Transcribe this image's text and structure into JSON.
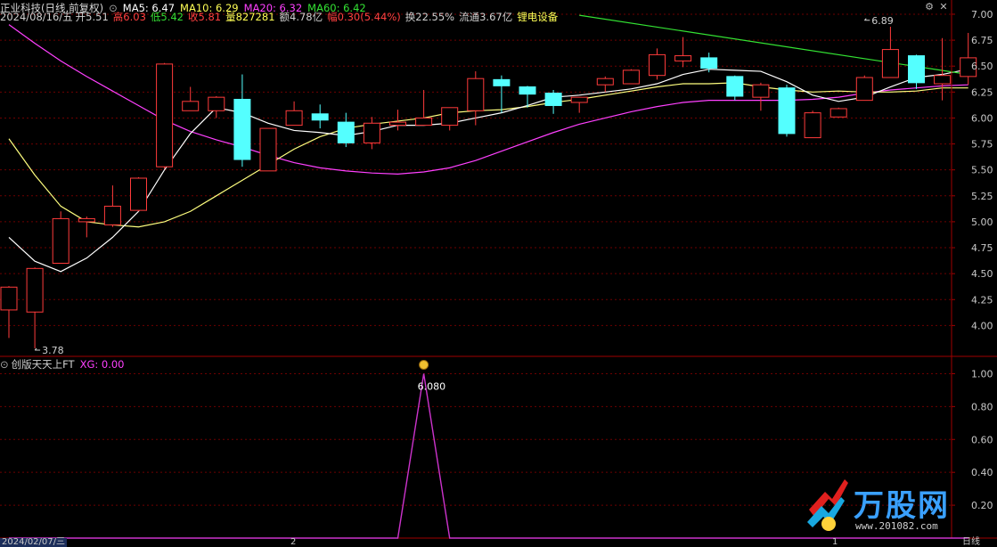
{
  "header": {
    "stock": "正业科技(日线,前复权)",
    "ma5": "MA5: 6.47",
    "ma10": "MA10: 6.29",
    "ma20": "MA20: 6.32",
    "ma60": "MA60: 6.42",
    "date": "2024/08/16/五",
    "open": "开5.51",
    "high": "高6.03",
    "low": "低5.42",
    "close": "收5.81",
    "volume": "量827281",
    "amount": "额4.78亿",
    "change": "幅0.30(5.44%)",
    "turnover": "换22.55%",
    "float_cap": "流通3.67亿",
    "sector": "锂电设备"
  },
  "indicator": {
    "name": "创版天天上FT",
    "value": "XG: 0.00",
    "peak_label": "6.080"
  },
  "footer": {
    "date_box": "2024/02/07/三",
    "mark1": "2",
    "mark2": "1",
    "period": "日线"
  },
  "window_controls": {
    "settings": "gear-icon",
    "close": "close-icon"
  },
  "brand": {
    "text": "万股网",
    "url": "www.201082.com"
  },
  "colors": {
    "up": "#ff3b3b",
    "down": "#54ffff",
    "ma5": "#ffffff",
    "ma10": "#ffff7f",
    "ma20": "#ff40ff",
    "ma60": "#33e233",
    "axis": "#a00000",
    "grid": "#6e0000"
  },
  "chart_data": [
    {
      "type": "candlestick",
      "title": "正业科技(日线,前复权)",
      "ylim": [
        3.72,
        7.12
      ],
      "y_ticks": [
        "7.00",
        "6.75",
        "6.50",
        "6.25",
        "6.00",
        "5.75",
        "5.50",
        "5.25",
        "5.00",
        "4.75",
        "4.50",
        "4.25",
        "4.00"
      ],
      "annotations": [
        {
          "label": "3.78",
          "x": 1,
          "y": 3.78
        },
        {
          "label": "6.89",
          "x": 33,
          "y": 6.89
        }
      ],
      "candles": [
        {
          "o": 4.15,
          "h": 4.38,
          "l": 3.88,
          "c": 4.37
        },
        {
          "o": 4.13,
          "h": 4.56,
          "l": 3.78,
          "c": 4.55
        },
        {
          "o": 4.6,
          "h": 5.1,
          "l": 4.6,
          "c": 5.03
        },
        {
          "o": 5.0,
          "h": 5.05,
          "l": 4.85,
          "c": 5.03
        },
        {
          "o": 4.97,
          "h": 5.35,
          "l": 4.95,
          "c": 5.15
        },
        {
          "o": 5.11,
          "h": 5.43,
          "l": 5.1,
          "c": 5.42
        },
        {
          "o": 5.53,
          "h": 6.53,
          "l": 5.51,
          "c": 6.52
        },
        {
          "o": 6.07,
          "h": 6.3,
          "l": 6.07,
          "c": 6.16
        },
        {
          "o": 6.07,
          "h": 6.21,
          "l": 6.0,
          "c": 6.2
        },
        {
          "o": 6.18,
          "h": 6.42,
          "l": 5.53,
          "c": 5.6
        },
        {
          "o": 5.49,
          "h": 5.9,
          "l": 5.49,
          "c": 5.9
        },
        {
          "o": 5.93,
          "h": 6.16,
          "l": 5.93,
          "c": 6.07
        },
        {
          "o": 6.04,
          "h": 6.13,
          "l": 5.9,
          "c": 5.98
        },
        {
          "o": 5.96,
          "h": 6.05,
          "l": 5.72,
          "c": 5.76
        },
        {
          "o": 5.76,
          "h": 6.01,
          "l": 5.7,
          "c": 5.95
        },
        {
          "o": 5.93,
          "h": 6.08,
          "l": 5.88,
          "c": 5.96
        },
        {
          "o": 5.93,
          "h": 6.27,
          "l": 5.93,
          "c": 6.0
        },
        {
          "o": 5.93,
          "h": 6.1,
          "l": 5.88,
          "c": 6.1
        },
        {
          "o": 6.07,
          "h": 6.45,
          "l": 5.93,
          "c": 6.38
        },
        {
          "o": 6.37,
          "h": 6.41,
          "l": 6.05,
          "c": 6.31
        },
        {
          "o": 6.3,
          "h": 6.31,
          "l": 6.1,
          "c": 6.23
        },
        {
          "o": 6.24,
          "h": 6.27,
          "l": 6.04,
          "c": 6.12
        },
        {
          "o": 6.15,
          "h": 6.2,
          "l": 6.05,
          "c": 6.2
        },
        {
          "o": 6.32,
          "h": 6.4,
          "l": 6.25,
          "c": 6.38
        },
        {
          "o": 6.33,
          "h": 6.47,
          "l": 6.33,
          "c": 6.46
        },
        {
          "o": 6.41,
          "h": 6.67,
          "l": 6.37,
          "c": 6.61
        },
        {
          "o": 6.55,
          "h": 6.78,
          "l": 6.49,
          "c": 6.6
        },
        {
          "o": 6.58,
          "h": 6.63,
          "l": 6.44,
          "c": 6.48
        },
        {
          "o": 6.4,
          "h": 6.41,
          "l": 6.17,
          "c": 6.21
        },
        {
          "o": 6.2,
          "h": 6.34,
          "l": 6.07,
          "c": 6.32
        },
        {
          "o": 6.29,
          "h": 6.32,
          "l": 5.82,
          "c": 5.85
        },
        {
          "o": 5.81,
          "h": 6.07,
          "l": 5.81,
          "c": 6.05
        },
        {
          "o": 6.01,
          "h": 6.1,
          "l": 6.01,
          "c": 6.09
        },
        {
          "o": 6.17,
          "h": 6.41,
          "l": 6.17,
          "c": 6.39
        },
        {
          "o": 6.39,
          "h": 6.88,
          "l": 6.39,
          "c": 6.66
        },
        {
          "o": 6.6,
          "h": 6.61,
          "l": 6.28,
          "c": 6.34
        },
        {
          "o": 6.33,
          "h": 6.77,
          "l": 6.17,
          "c": 6.41
        },
        {
          "o": 6.4,
          "h": 6.82,
          "l": 6.32,
          "c": 6.58
        }
      ],
      "ma5": [
        4.85,
        4.62,
        4.52,
        4.65,
        4.85,
        5.1,
        5.5,
        5.85,
        6.1,
        6.05,
        5.95,
        5.88,
        5.86,
        5.83,
        5.87,
        5.93,
        5.93,
        5.95,
        6.0,
        6.05,
        6.12,
        6.2,
        6.22,
        6.25,
        6.28,
        6.33,
        6.42,
        6.47,
        6.46,
        6.45,
        6.35,
        6.22,
        6.16,
        6.2,
        6.3,
        6.39,
        6.42,
        6.47
      ],
      "ma10": [
        5.8,
        5.45,
        5.15,
        5.0,
        4.97,
        4.95,
        5.0,
        5.1,
        5.25,
        5.4,
        5.55,
        5.7,
        5.82,
        5.9,
        5.94,
        5.97,
        6.0,
        6.05,
        6.07,
        6.08,
        6.11,
        6.15,
        6.18,
        6.22,
        6.26,
        6.3,
        6.33,
        6.33,
        6.34,
        6.3,
        6.27,
        6.25,
        6.26,
        6.25,
        6.25,
        6.26,
        6.29,
        6.29
      ],
      "ma20": [
        6.9,
        6.72,
        6.55,
        6.4,
        6.26,
        6.12,
        5.98,
        5.87,
        5.79,
        5.72,
        5.64,
        5.57,
        5.52,
        5.49,
        5.47,
        5.46,
        5.48,
        5.52,
        5.59,
        5.68,
        5.77,
        5.86,
        5.94,
        6.0,
        6.06,
        6.11,
        6.15,
        6.17,
        6.17,
        6.17,
        6.17,
        6.18,
        6.2,
        6.24,
        6.27,
        6.29,
        6.31,
        6.32
      ],
      "ma60_segment": {
        "from_x": 22,
        "to_x": 37,
        "values": [
          6.99,
          6.42
        ]
      }
    },
    {
      "type": "line",
      "title": "创版天天上FT",
      "ylim": [
        0,
        1.1
      ],
      "y_ticks": [
        "1.00",
        "0.80",
        "0.60",
        "0.40",
        "0.20"
      ],
      "values": [
        0,
        0,
        0,
        0,
        0,
        0,
        0,
        0,
        0,
        0,
        0,
        0,
        0,
        0,
        0,
        0,
        1,
        0,
        0,
        0,
        0,
        0,
        0,
        0,
        0,
        0,
        0,
        0,
        0,
        0,
        0,
        0,
        0,
        0,
        0,
        0,
        0,
        0
      ],
      "peak_label": "6.080",
      "peak_index": 16
    }
  ]
}
